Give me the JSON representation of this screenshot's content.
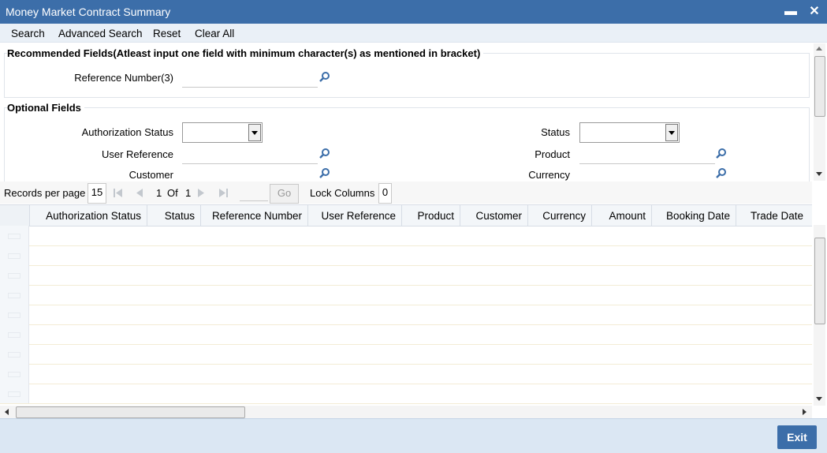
{
  "window": {
    "title": "Money Market Contract Summary",
    "minimize_glyph": "▬",
    "close_glyph": "✕"
  },
  "toolbar": {
    "search": "Search",
    "advanced_search": "Advanced Search",
    "reset": "Reset",
    "clear_all": "Clear All"
  },
  "recommended": {
    "legend": "Recommended Fields(Atleast input one field with minimum character(s) as mentioned in bracket)",
    "reference_label": "Reference Number(3)",
    "reference_value": ""
  },
  "optional": {
    "legend": "Optional Fields",
    "authorization_status_label": "Authorization Status",
    "authorization_status_value": "",
    "status_label": "Status",
    "status_value": "",
    "user_reference_label": "User Reference",
    "user_reference_value": "",
    "product_label": "Product",
    "product_value": "",
    "customer_label": "Customer",
    "customer_value": "",
    "currency_label": "Currency",
    "currency_value": ""
  },
  "pager": {
    "records_per_page_label": "Records per page",
    "records_per_page": "15",
    "current_page": "1",
    "of_label": "Of",
    "total_pages": "1",
    "go_label": "Go",
    "lock_columns_label": "Lock Columns",
    "lock_columns": "0"
  },
  "grid": {
    "columns": [
      "Authorization Status",
      "Status",
      "Reference Number",
      "User Reference",
      "Product",
      "Customer",
      "Currency",
      "Amount",
      "Booking Date",
      "Trade Date"
    ],
    "rows": []
  },
  "footer": {
    "exit_label": "Exit"
  },
  "icons": {
    "lookup": "magnifier-icon",
    "first": "first-page-icon",
    "prev": "prev-page-icon",
    "next": "next-page-icon",
    "last": "last-page-icon"
  },
  "colors": {
    "titlebar": "#3c6ea9",
    "footer": "#dbe7f3",
    "accent": "#3c6ea9"
  }
}
